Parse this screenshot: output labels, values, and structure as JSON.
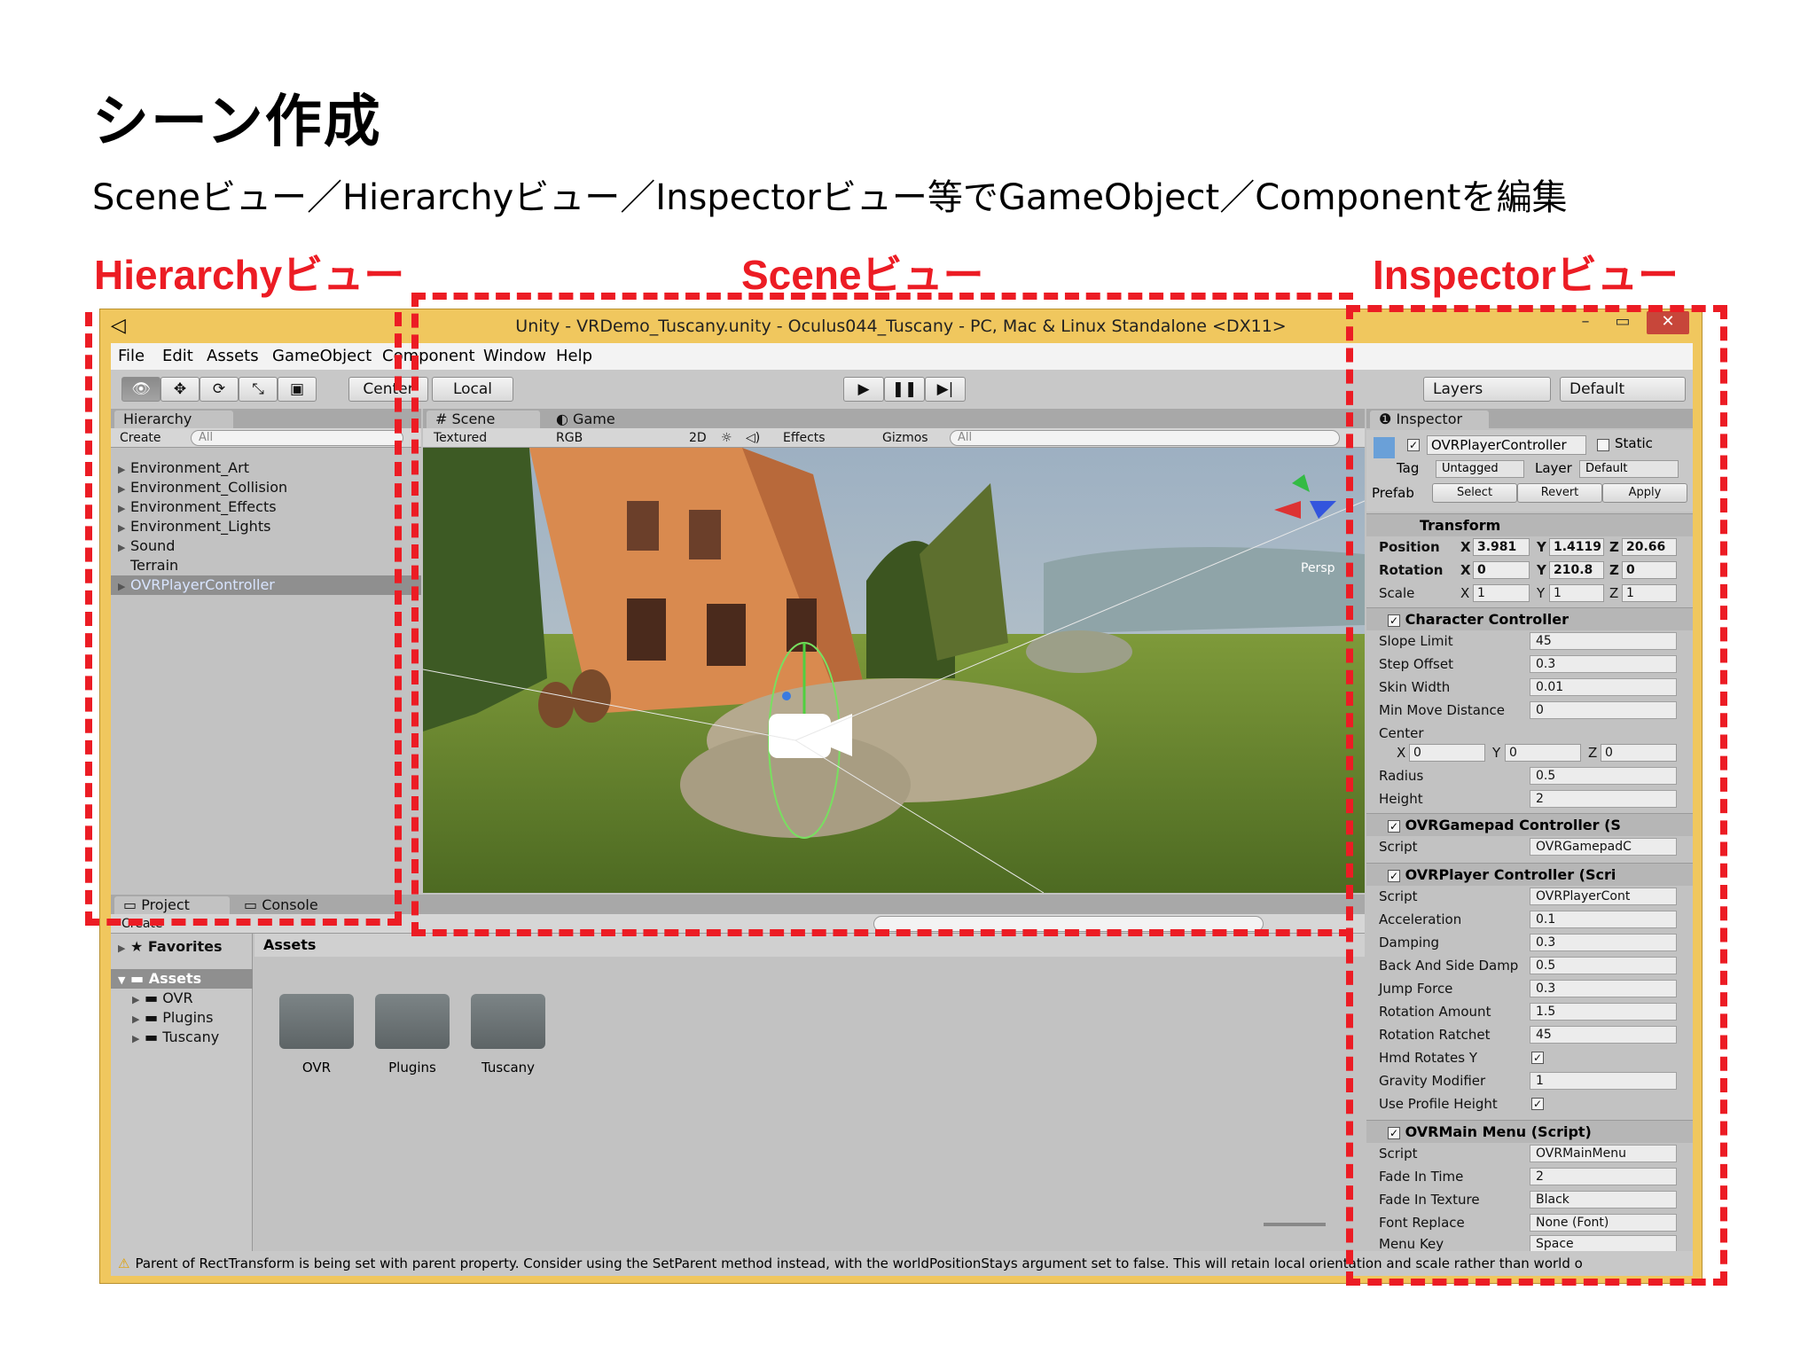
{
  "slide": {
    "title": "シーン作成",
    "subtitle": "Sceneビュー／Hierarchyビュー／Inspectorビュー等でGameObject／Componentを編集",
    "labels": {
      "hierarchy": "Hierarchyビュー",
      "scene": "Sceneビュー",
      "inspector": "Inspectorビュー"
    },
    "accent_color": "#ec1c24"
  },
  "window": {
    "title": "Unity - VRDemo_Tuscany.unity - Oculus044_Tuscany - PC, Mac & Linux Standalone <DX11>",
    "minimize": "–",
    "maximize": "▭",
    "close": "✕"
  },
  "menubar": [
    "File",
    "Edit",
    "Assets",
    "GameObject",
    "Component",
    "Window",
    "Help"
  ],
  "toolbar": {
    "pivot": "Center",
    "space": "Local",
    "layers": "Layers",
    "layout": "Default"
  },
  "hierarchy": {
    "tab": "Hierarchy",
    "create": "Create",
    "search_placeholder": "All",
    "items": [
      "Environment_Art",
      "Environment_Collision",
      "Environment_Effects",
      "Environment_Lights",
      "Sound",
      "Terrain",
      "OVRPlayerController"
    ]
  },
  "scene": {
    "tab_scene": "Scene",
    "tab_game": "Game",
    "draw_mode": "Textured",
    "render_mode": "RGB",
    "mode_2d": "2D",
    "effects": "Effects",
    "gizmos": "Gizmos",
    "search_placeholder": "All",
    "persp": "Persp"
  },
  "project": {
    "tab_project": "Project",
    "tab_console": "Console",
    "create": "Create",
    "favorites": "Favorites",
    "assets_label": "Assets",
    "breadcrumb": "Assets",
    "tree": [
      "OVR",
      "Plugins",
      "Tuscany"
    ],
    "folders": [
      "OVR",
      "Plugins",
      "Tuscany"
    ]
  },
  "inspector": {
    "tab": "Inspector",
    "object_name": "OVRPlayerController",
    "static": "Static",
    "tag_label": "Tag",
    "tag_value": "Untagged",
    "layer_label": "Layer",
    "layer_value": "Default",
    "prefab_label": "Prefab",
    "prefab_select": "Select",
    "prefab_revert": "Revert",
    "prefab_apply": "Apply",
    "transform": {
      "header": "Transform",
      "position": {
        "label": "Position",
        "x": "3.981",
        "y": "1.4119",
        "z": "20.66"
      },
      "rotation": {
        "label": "Rotation",
        "x": "0",
        "y": "210.8",
        "z": "0"
      },
      "scale": {
        "label": "Scale",
        "x": "1",
        "y": "1",
        "z": "1"
      }
    },
    "character_controller": {
      "header": "Character Controller",
      "rows": [
        {
          "label": "Slope Limit",
          "value": "45"
        },
        {
          "label": "Step Offset",
          "value": "0.3"
        },
        {
          "label": "Skin Width",
          "value": "0.01"
        },
        {
          "label": "Min Move Distance",
          "value": "0"
        }
      ],
      "center_label": "Center",
      "center": {
        "x": "0",
        "y": "0",
        "z": "0"
      },
      "rows2": [
        {
          "label": "Radius",
          "value": "0.5"
        },
        {
          "label": "Height",
          "value": "2"
        }
      ]
    },
    "gamepad": {
      "header": "OVRGamepad Controller (S",
      "script_label": "Script",
      "script_value": "OVRGamepadC"
    },
    "player": {
      "header": "OVRPlayer Controller (Scri",
      "rows": [
        {
          "label": "Script",
          "value": "OVRPlayerCont"
        },
        {
          "label": "Acceleration",
          "value": "0.1"
        },
        {
          "label": "Damping",
          "value": "0.3"
        },
        {
          "label": "Back And Side Damp",
          "value": "0.5"
        },
        {
          "label": "Jump Force",
          "value": "0.3"
        },
        {
          "label": "Rotation Amount",
          "value": "1.5"
        },
        {
          "label": "Rotation Ratchet",
          "value": "45"
        },
        {
          "label": "Hmd Rotates Y",
          "value": "✓"
        },
        {
          "label": "Gravity Modifier",
          "value": "1"
        },
        {
          "label": "Use Profile Height",
          "value": "✓"
        }
      ]
    },
    "mainmenu": {
      "header": "OVRMain Menu (Script)",
      "rows": [
        {
          "label": "Script",
          "value": "OVRMainMenu"
        },
        {
          "label": "Fade In Time",
          "value": "2"
        },
        {
          "label": "Fade In Texture",
          "value": "Black"
        },
        {
          "label": "Font Replace",
          "value": "None (Font)"
        },
        {
          "label": "Menu Key",
          "value": "Space"
        }
      ]
    }
  },
  "status": {
    "message": "Parent of RectTransform is being set with parent property. Consider using the SetParent method instead, with the worldPositionStays argument set to false. This will retain local orientation and scale rather than world o"
  }
}
